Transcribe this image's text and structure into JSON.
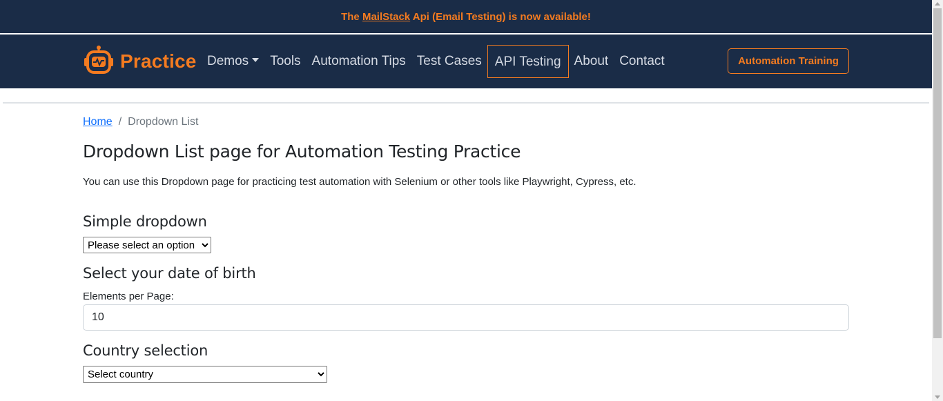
{
  "announcement": {
    "prefix": "The ",
    "link": "MailStack",
    "suffix": " Api (Email Testing) is now available!"
  },
  "brand": {
    "name": "Practice",
    "icon": "robot-icon"
  },
  "nav": {
    "items": [
      {
        "label": "Demos",
        "dropdown": true
      },
      {
        "label": "Tools"
      },
      {
        "label": "Automation Tips"
      },
      {
        "label": "Test Cases"
      },
      {
        "label": "API Testing",
        "active": true
      },
      {
        "label": "About"
      },
      {
        "label": "Contact"
      }
    ],
    "cta": "Automation Training"
  },
  "breadcrumb": {
    "home": "Home",
    "separator": "/",
    "current": "Dropdown List"
  },
  "main": {
    "title": "Dropdown List page for Automation Testing Practice",
    "intro": "You can use this Dropdown page for practicing test automation with Selenium or other tools like Playwright, Cypress, etc.",
    "simple_dropdown": {
      "heading": "Simple dropdown",
      "selected": "Please select an option"
    },
    "dob": {
      "heading": "Select your date of birth",
      "label": "Elements per Page:",
      "value": "10"
    },
    "country": {
      "heading": "Country selection",
      "selected": "Select country"
    }
  },
  "colors": {
    "navy": "#1a2c47",
    "accent": "#f47b20",
    "link": "#0d6efd"
  }
}
